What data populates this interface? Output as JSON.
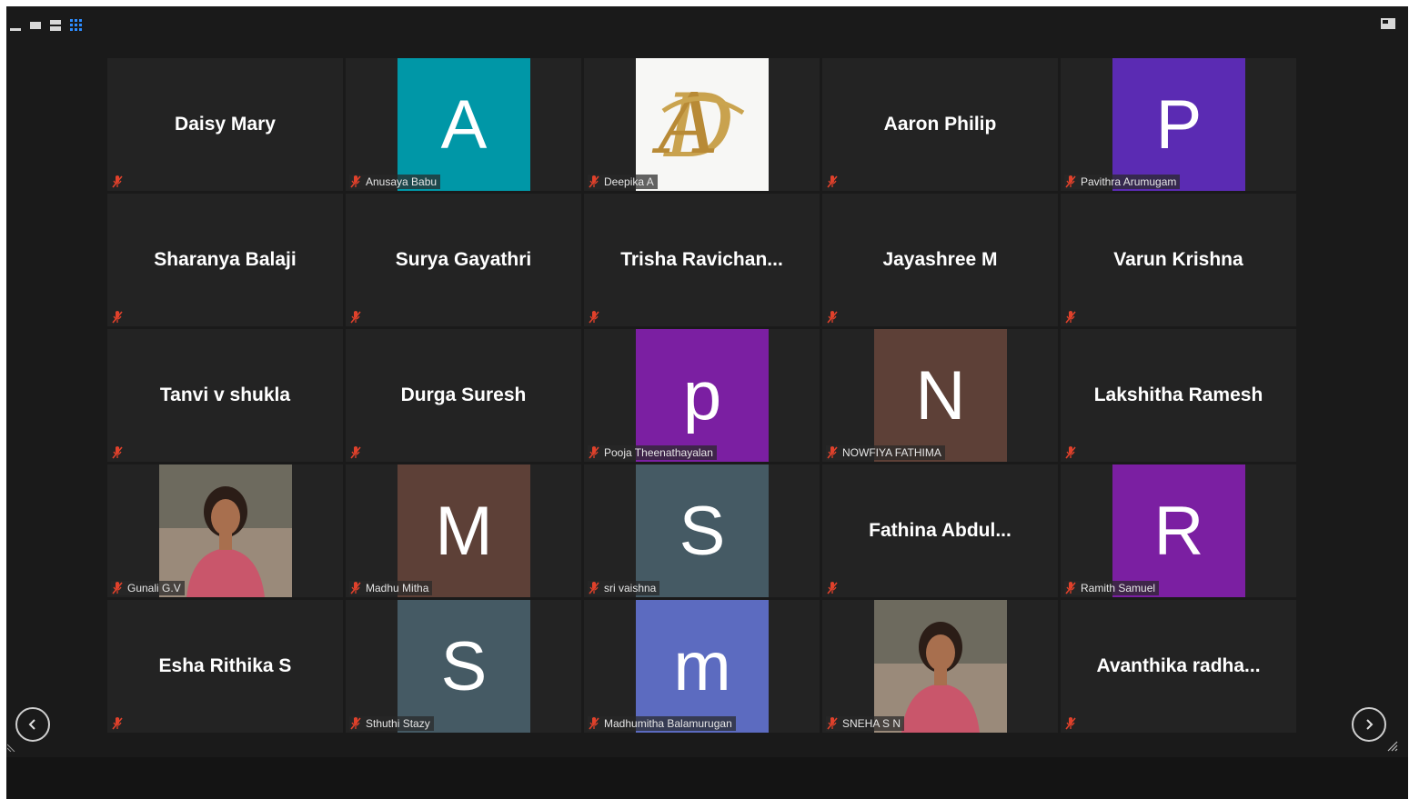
{
  "window": {
    "background": "#1a1a1a",
    "tile_background": "#232323"
  },
  "toolbar": {
    "view_icons": [
      "minimize-icon",
      "speaker-view-icon",
      "strip-view-icon",
      "gallery-view-icon"
    ],
    "gallery_active_color": "#2d8cff",
    "layout_icon": "layout-toggle-icon"
  },
  "navigation": {
    "prev_icon": "chevron-left-icon",
    "next_icon": "chevron-right-icon"
  },
  "mic_muted_color": "#e0412b",
  "participants": [
    {
      "display_name": "Daisy Mary"
    },
    {
      "avatar_letter": "A",
      "avatar_color": "#0097a7",
      "label": "Anusaya Babu"
    },
    {
      "photo": "logo-ad",
      "label": "Deepika A"
    },
    {
      "display_name": "Aaron Philip"
    },
    {
      "avatar_letter": "P",
      "avatar_color": "#5b2bb3",
      "label": "Pavithra Arumugam"
    },
    {
      "display_name": "Sharanya Balaji"
    },
    {
      "display_name": "Surya Gayathri"
    },
    {
      "display_name": "Trisha  Ravichan..."
    },
    {
      "display_name": "Jayashree M"
    },
    {
      "display_name": "Varun Krishna"
    },
    {
      "display_name": "Tanvi v shukla"
    },
    {
      "display_name": "Durga Suresh"
    },
    {
      "avatar_letter": "p",
      "avatar_color": "#7b1fa2",
      "label": "Pooja Theenathayalan"
    },
    {
      "avatar_letter": "N",
      "avatar_color": "#5d4037",
      "label": "NOWFIYA FATHIMA"
    },
    {
      "display_name": "Lakshitha Ramesh"
    },
    {
      "photo": "person-photo",
      "label": "Gunali G.V"
    },
    {
      "avatar_letter": "M",
      "avatar_color": "#5d4037",
      "label": "Madhu Mitha"
    },
    {
      "avatar_letter": "S",
      "avatar_color": "#455a64",
      "label": "sri vaishna"
    },
    {
      "display_name": "Fathina  Abdul..."
    },
    {
      "avatar_letter": "R",
      "avatar_color": "#7b1fa2",
      "label": "Ramith Samuel"
    },
    {
      "display_name": "Esha Rithika S"
    },
    {
      "avatar_letter": "S",
      "avatar_color": "#455a64",
      "label": "Sthuthi Stazy"
    },
    {
      "avatar_letter": "m",
      "avatar_color": "#5c6bc0",
      "label": "Madhumitha Balamurugan"
    },
    {
      "photo": "person-photo",
      "label": "SNEHA S N"
    },
    {
      "display_name": "Avanthika  radha..."
    }
  ]
}
